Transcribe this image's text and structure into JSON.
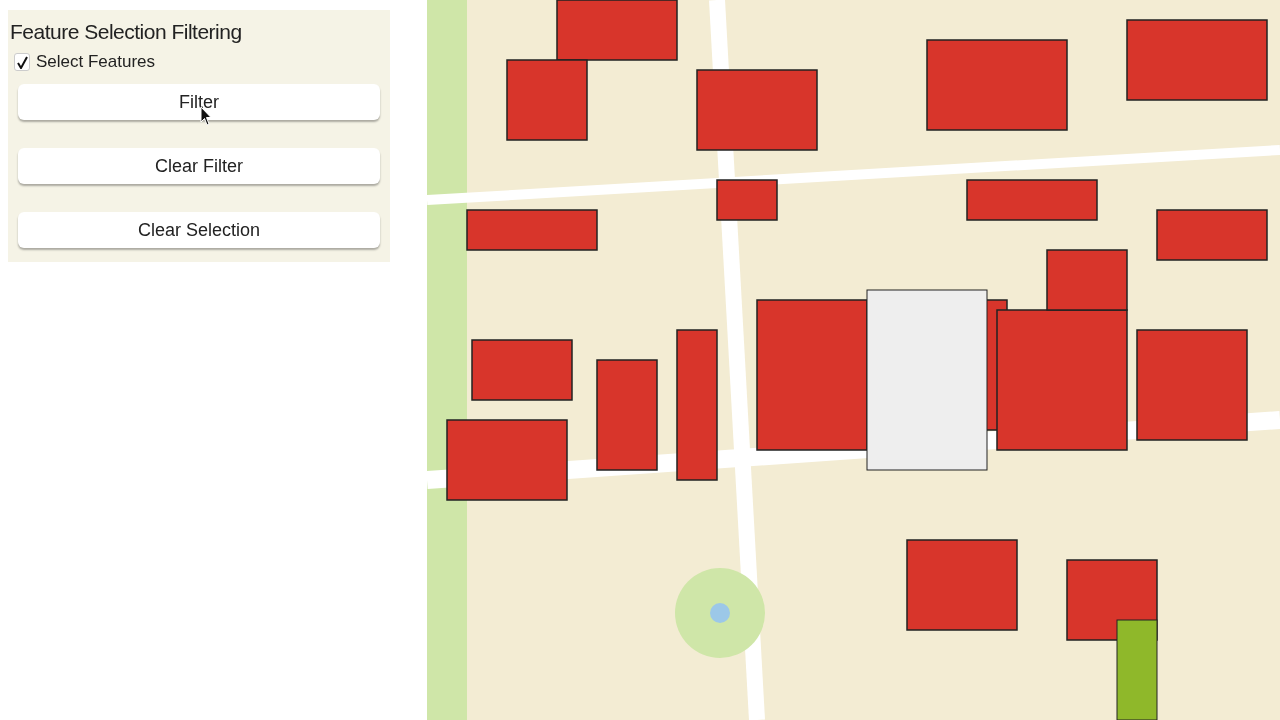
{
  "panel": {
    "title": "Feature Selection Filtering",
    "checkbox": {
      "label": "Select Features",
      "checked": true
    },
    "buttons": [
      {
        "label": "Filter"
      },
      {
        "label": "Clear Filter"
      },
      {
        "label": "Clear Selection"
      }
    ]
  }
}
